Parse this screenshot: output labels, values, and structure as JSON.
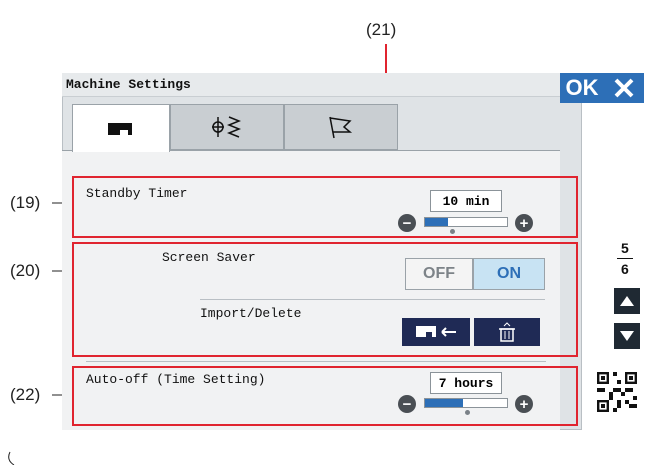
{
  "callouts": {
    "c21": "(21)",
    "c19": "(19)",
    "c20": "(20)",
    "c22": "(22)"
  },
  "window": {
    "title": "Machine Settings",
    "ok_label": "OK"
  },
  "tabs": [
    {
      "icon": "sewing-machine-icon"
    },
    {
      "icon": "stitch-icon"
    },
    {
      "icon": "flag-icon"
    }
  ],
  "standby": {
    "label": "Standby Timer",
    "value": "10 min",
    "level_percent": 28
  },
  "screensaver": {
    "label": "Screen Saver",
    "off": "OFF",
    "on": "ON",
    "selected": "ON"
  },
  "import": {
    "label": "Import/Delete"
  },
  "autooff": {
    "label": "Auto-off (Time Setting)",
    "value": "7 hours",
    "level_percent": 46
  },
  "pager": {
    "current": "5",
    "total": "6"
  },
  "colors": {
    "accent": "#2d6fb7",
    "callout_box": "#e0242f",
    "dark_button": "#1f2a55"
  }
}
